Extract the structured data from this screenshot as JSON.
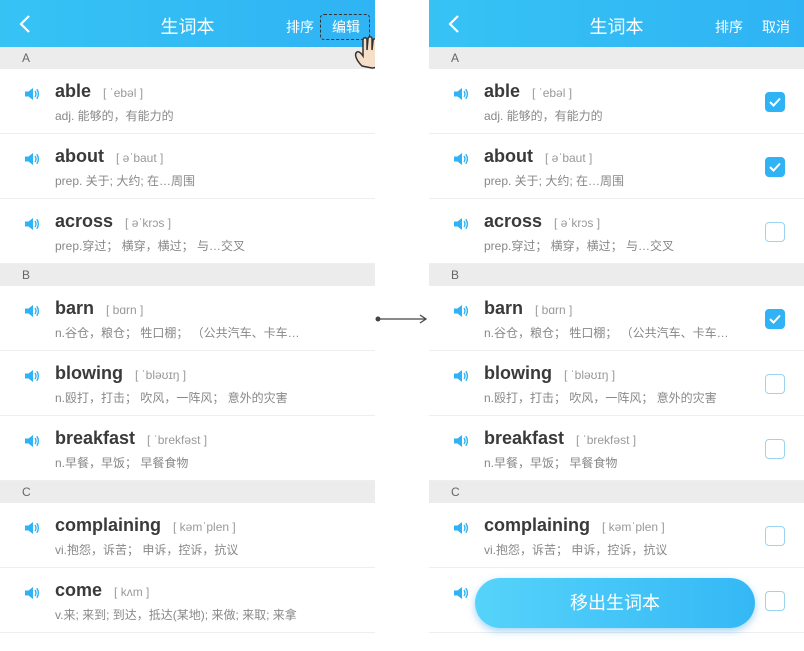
{
  "left": {
    "title": "生词本",
    "sort_label": "排序",
    "edit_label": "编辑"
  },
  "right": {
    "title": "生词本",
    "sort_label": "排序",
    "cancel_label": "取消",
    "remove_label": "移出生词本"
  },
  "sections": [
    {
      "letter": "A",
      "words": [
        {
          "word": "able",
          "phonetic": "[ ˈebəl ]",
          "definition": "adj.  能够的，有能力的",
          "checked": true
        },
        {
          "word": "about",
          "phonetic": "[ əˈbaut ]",
          "definition": "prep.  关于; 大约; 在…周围",
          "checked": true
        },
        {
          "word": "across",
          "phonetic": "[ əˈkrɔs ]",
          "definition": "prep.穿过；  横穿，横过；  与…交叉",
          "checked": false
        }
      ]
    },
    {
      "letter": "B",
      "words": [
        {
          "word": "barn",
          "phonetic": "[ bɑrn ]",
          "definition": "n.谷仓，粮仓；  牲口棚；  （公共汽车、卡车…",
          "checked": true
        },
        {
          "word": "blowing",
          "phonetic": "[ ˈbləʊɪŋ ]",
          "definition": "n.殴打，打击；  吹风，一阵风；  意外的灾害",
          "checked": false
        },
        {
          "word": "breakfast",
          "phonetic": "[ ˈbrekfəst ]",
          "definition": "n.早餐，早饭；  早餐食物",
          "checked": false
        }
      ]
    },
    {
      "letter": "C",
      "words": [
        {
          "word": "complaining",
          "phonetic": "[ kəmˈplen ]",
          "definition": "vi.抱怨，诉苦；  申诉，控诉，抗议",
          "checked": false
        },
        {
          "word": "come",
          "phonetic": "[ kʌm ]",
          "definition": "v.来; 来到; 到达，抵达(某地); 来做; 来取; 来拿",
          "checked": false
        }
      ]
    }
  ],
  "colors": {
    "accent": "#2fb3f4",
    "section_bg": "#ececec"
  }
}
